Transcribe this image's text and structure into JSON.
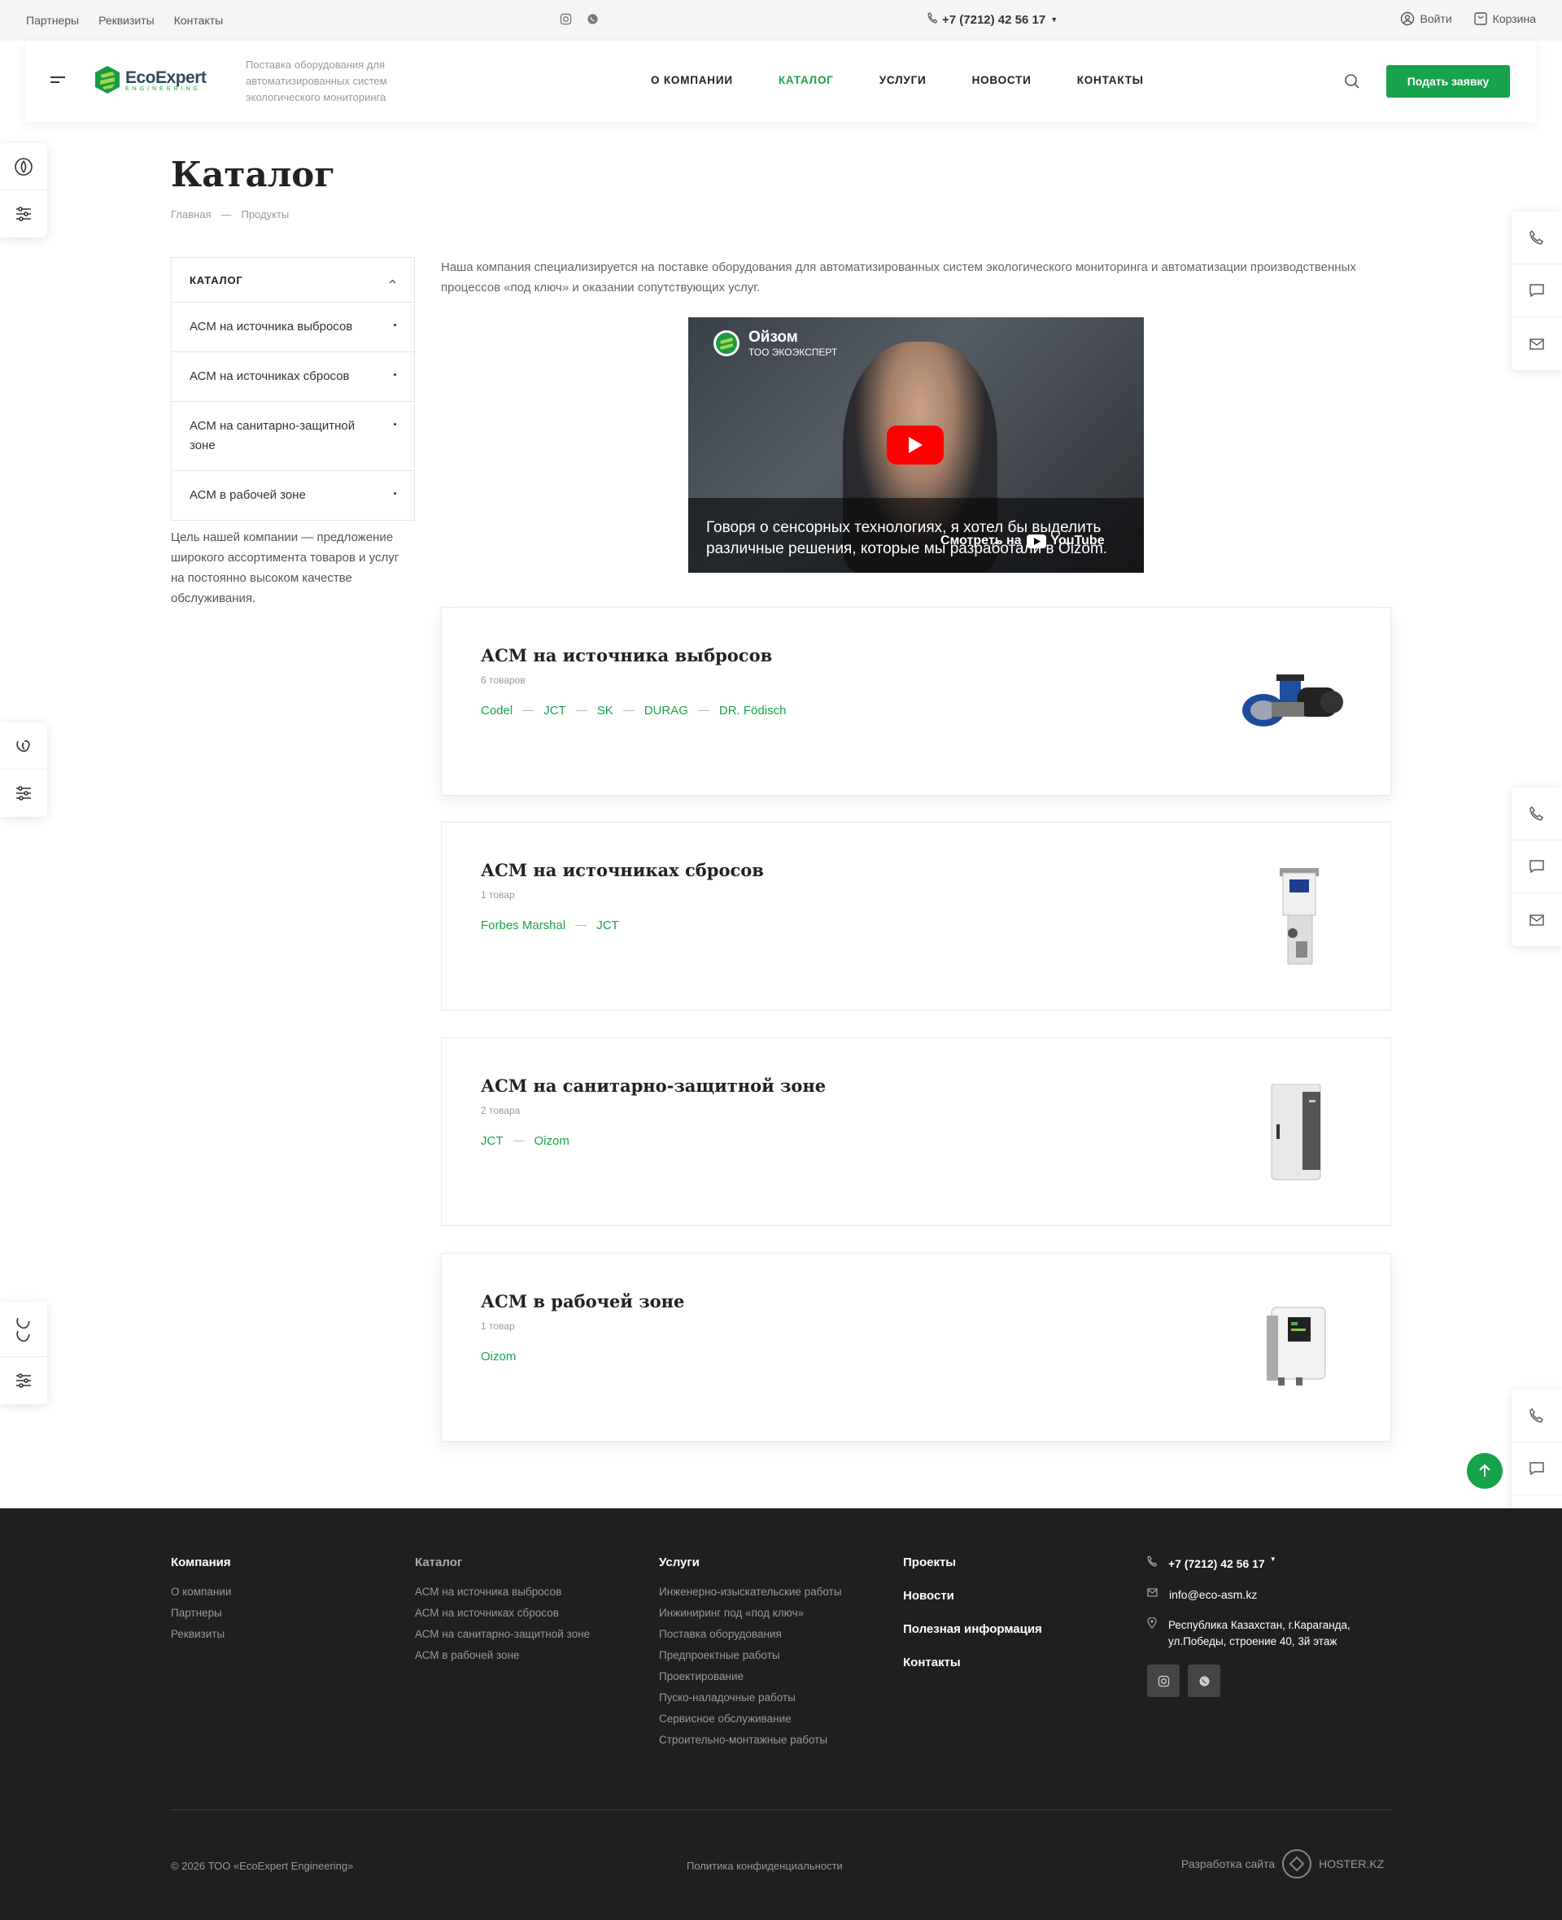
{
  "topbar": {
    "links": [
      "Партнеры",
      "Реквизиты",
      "Контакты"
    ],
    "phone": "+7 (7212) 42 56 17",
    "login": "Войти",
    "cart": "Корзина"
  },
  "header": {
    "logo_text": "EcoExpert",
    "logo_sub": "ENGINEERING",
    "tagline": "Поставка оборудования для автоматизированных систем экологического мониторинга",
    "nav": [
      "О КОМПАНИИ",
      "КАТАЛОГ",
      "УСЛУГИ",
      "НОВОСТИ",
      "КОНТАКТЫ"
    ],
    "cta": "Подать заявку"
  },
  "page": {
    "title": "Каталог",
    "breadcrumb": [
      "Главная",
      "Продукты"
    ]
  },
  "catalog_menu": {
    "title": "КАТАЛОГ",
    "items": [
      "АСМ на источника выбросов",
      "АСМ на источниках сбросов",
      "АСМ на санитарно-защитной зоне",
      "АСМ в рабочей зоне"
    ]
  },
  "company_note": "Цель нашей компании — предложение широкого ассортимента товаров и услуг на постоянно высоком качестве обслуживания.",
  "intro": "Наша компания специализируется на поставке оборудования для автоматизированных систем экологического мониторинга и автоматизации производственных процессов «под ключ» и оказании сопутствующих услуг.",
  "video": {
    "channel": "Ойзом",
    "channel_sub": "ТОО ЭКОЭКСПЕРТ",
    "caption": "Говоря о сенсорных технологиях, я хотел бы выделить различные решения, которые мы разработали в Oizom.",
    "watch": "Смотреть на",
    "youtube": "YouTube"
  },
  "categories": [
    {
      "title": "АСМ на источника выбросов",
      "count": "6 товаров",
      "brands": [
        "Codel",
        "JCT",
        "SK",
        "DURAG",
        "DR. Födisch"
      ]
    },
    {
      "title": "АСМ на источниках сбросов",
      "count": "1 товар",
      "brands": [
        "Forbes Marshal",
        "JCT"
      ]
    },
    {
      "title": "АСМ на санитарно-защитной зоне",
      "count": "2 товара",
      "brands": [
        "JCT",
        "Oizom"
      ]
    },
    {
      "title": "АСМ в рабочей зоне",
      "count": "1 товар",
      "brands": [
        "Oizom"
      ]
    }
  ],
  "footer": {
    "company": {
      "title": "Компания",
      "links": [
        "О компании",
        "Партнеры",
        "Реквизиты"
      ]
    },
    "catalog": {
      "title": "Каталог",
      "links": [
        "АСМ на источника выбросов",
        "АСМ на источниках сбросов",
        "АСМ на санитарно-защитной зоне",
        "АСМ в рабочей зоне"
      ]
    },
    "services": {
      "title": "Услуги",
      "links": [
        "Инженерно-изыскательские работы",
        "Инжиниринг под «под ключ»",
        "Поставка оборудования",
        "Предпроектные работы",
        "Проектирование",
        "Пуско-наладочные работы",
        "Сервисное обслуживание",
        "Строительно-монтажные работы"
      ]
    },
    "more": [
      "Проекты",
      "Новости",
      "Полезная информация",
      "Контакты"
    ],
    "phone": "+7 (7212) 42 56 17",
    "email": "info@eco-asm.kz",
    "address": "Республика Казахстан, г.Караганда, ул.Победы, строение 40, 3й этаж",
    "copyright": "© 2026 ТОО «EcoExpert Engineering»",
    "privacy": "Политика конфиденциальности",
    "dev_label": "Разработка сайта",
    "dev_name": "HOSTER.KZ"
  },
  "colors": {
    "accent": "#16a34a",
    "footer_bg": "#1f1f1f",
    "text": "#333333"
  }
}
